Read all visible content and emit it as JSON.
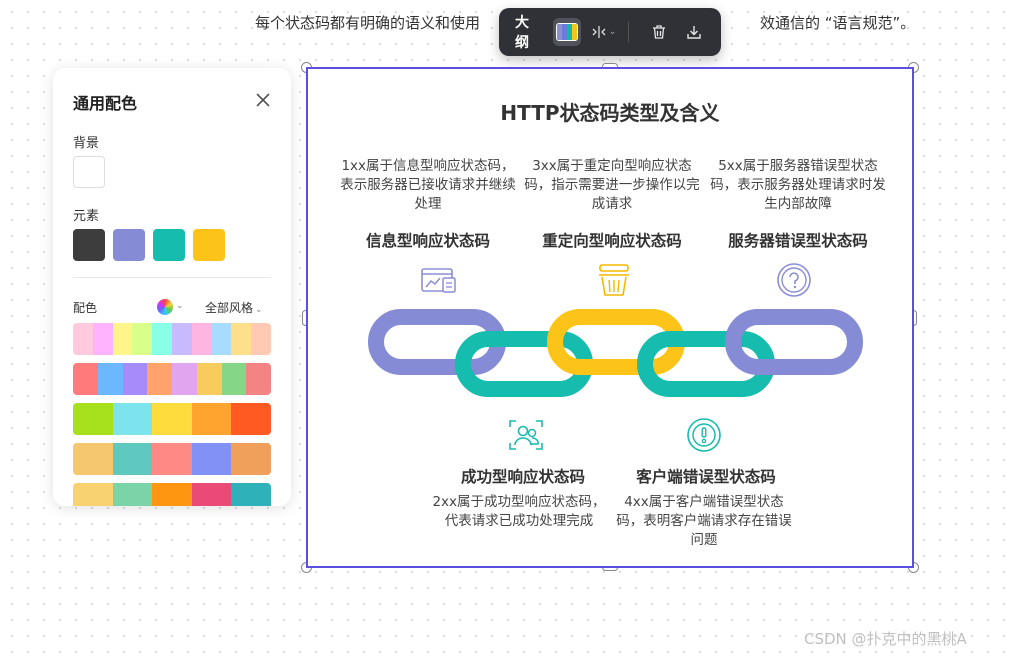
{
  "page": {
    "intro_text_left": "每个状态码都有明确的语义和使用",
    "intro_text_right": "效通信的 “语言规范”。"
  },
  "toolbar": {
    "outline_label": "大纲",
    "theme_colors": [
      "#8a8fd6",
      "#6a7bd8",
      "#14b8a6",
      "#f5c518"
    ],
    "layout_icon": "mirror-layout-icon",
    "layout_caret": "⌄",
    "delete_icon": "trash-icon",
    "download_icon": "download-icon"
  },
  "panel": {
    "title": "通用配色",
    "background_label": "背景",
    "background_color": "#ffffff",
    "elements_label": "元素",
    "element_colors": [
      "#3d3d3d",
      "#858bd4",
      "#16bcad",
      "#fcc419"
    ],
    "palette_label": "配色",
    "style_label": "全部风格",
    "palettes": [
      [
        "#ffc9de",
        "#ffb3ff",
        "#fff58a",
        "#d7ff8a",
        "#8affe8",
        "#c8baff",
        "#ffb5e1",
        "#a8dcff",
        "#ffe08a",
        "#ffc9b3"
      ],
      [
        "#ff7a7a",
        "#6cb7ff",
        "#a78bfa",
        "#ffa26b",
        "#e1a5ef",
        "#f7cc5d",
        "#85d687",
        "#f48484"
      ],
      [
        "#a7e01c",
        "#7de4ee",
        "#ffdc3d",
        "#ffa52f",
        "#ff5a22"
      ],
      [
        "#f5c76f",
        "#5fc8bf",
        "#ff8a84",
        "#8191f5",
        "#f0a05a"
      ],
      [
        "#f8d271",
        "#7ad4a8",
        "#ff9611",
        "#e94b76",
        "#2fb1b9"
      ]
    ]
  },
  "infographic": {
    "title": "HTTP状态码类型及含义",
    "items": [
      {
        "heading": "信息型响应状态码",
        "desc": "1xx属于信息型响应状态码，表示服务器已接收请求并继续处理",
        "icon": "dashboard-chart-icon"
      },
      {
        "heading": "重定向型响应状态码",
        "desc": "3xx属于重定向型响应状态码，指示需要进一步操作以完成请求",
        "icon": "basket-icon"
      },
      {
        "heading": "服务器错误型状态码",
        "desc": "5xx属于服务器错误型状态码，表示服务器处理请求时发生内部故障",
        "icon": "question-circle-icon"
      },
      {
        "heading": "成功型响应状态码",
        "desc": "2xx属于成功型响应状态码，代表请求已成功处理完成",
        "icon": "user-group-icon"
      },
      {
        "heading": "客户端错误型状态码",
        "desc": "4xx属于客户端错误型状态码，表明客户端请求存在错误问题",
        "icon": "exclamation-circle-icon"
      }
    ],
    "chain_colors": [
      "#858bd4",
      "#16bcad",
      "#fcc419",
      "#16bcad",
      "#858bd4"
    ]
  },
  "watermark": "CSDN @扑克中的黑桃A"
}
